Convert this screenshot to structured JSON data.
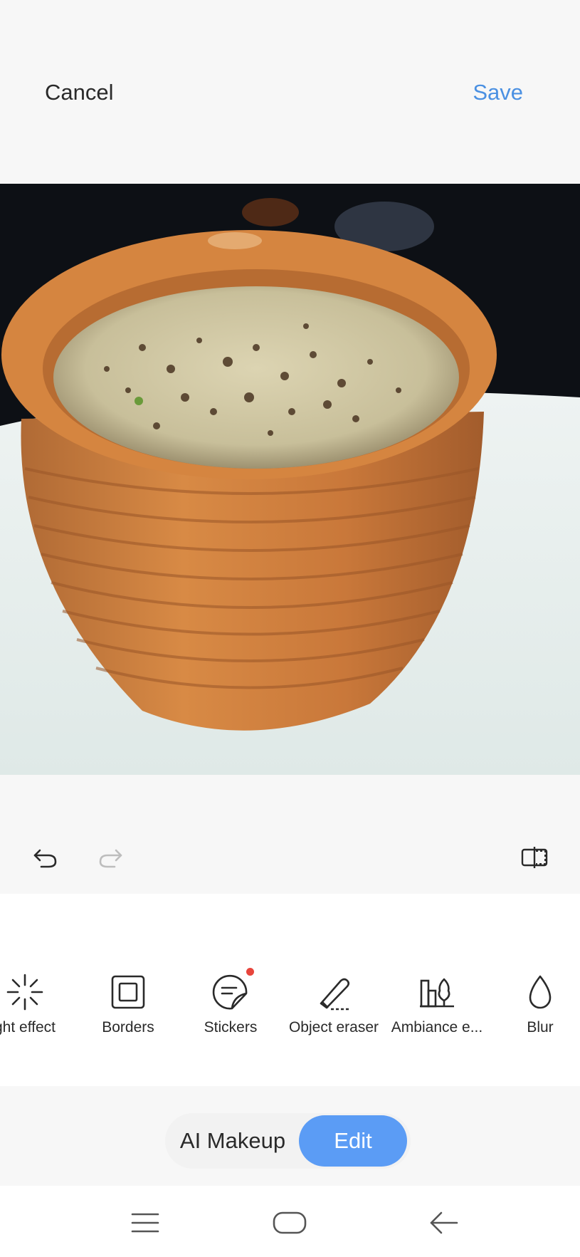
{
  "header": {
    "cancel_label": "Cancel",
    "save_label": "Save"
  },
  "photo": {
    "subject": "clay cup of tea with spices on a white plate"
  },
  "history": {
    "undo_icon": "undo-icon",
    "redo_icon": "redo-icon",
    "compare_icon": "compare-icon"
  },
  "tools": [
    {
      "label": "ght effect",
      "icon": "light-effect-icon"
    },
    {
      "label": "Borders",
      "icon": "borders-icon"
    },
    {
      "label": "Stickers",
      "icon": "stickers-icon",
      "badge": true
    },
    {
      "label": "Object eraser",
      "icon": "object-eraser-icon"
    },
    {
      "label": "Ambiance e...",
      "icon": "ambiance-icon"
    },
    {
      "label": "Blur",
      "icon": "blur-icon"
    }
  ],
  "modes": {
    "ai_makeup": "AI Makeup",
    "edit": "Edit",
    "active": "Edit"
  },
  "colors": {
    "accent": "#4a90e2",
    "active_pill": "#5b9cf5",
    "badge": "#e8453c"
  },
  "navbar": {
    "menu_icon": "menu-icon",
    "home_icon": "home-icon",
    "back_icon": "back-icon"
  }
}
